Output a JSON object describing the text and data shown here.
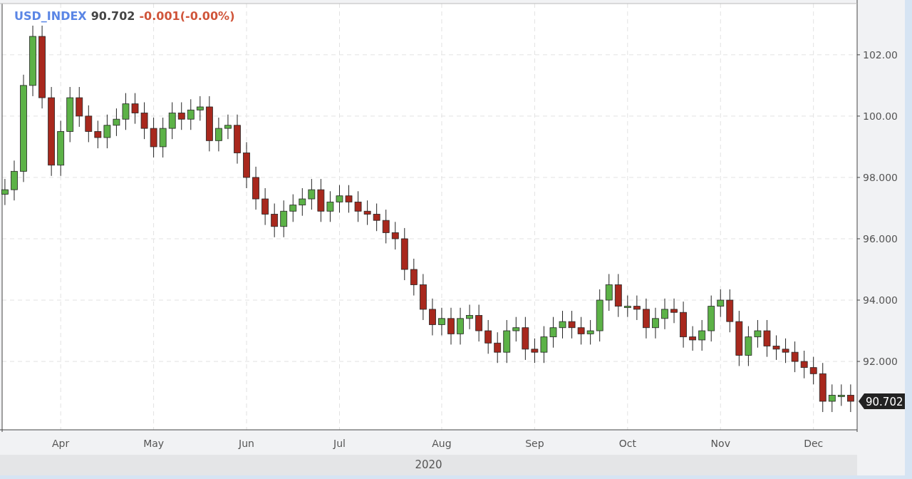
{
  "header": {
    "symbol": "USD_INDEX",
    "price": "90.702",
    "change": "-0.001(-0.00%)"
  },
  "chart_data": {
    "type": "candlestick",
    "grid": true,
    "categories": [
      null,
      null,
      null,
      null,
      null,
      null,
      "Apr",
      null,
      null,
      null,
      null,
      null,
      null,
      null,
      null,
      null,
      "May",
      null,
      null,
      null,
      null,
      null,
      null,
      null,
      null,
      null,
      "Jun",
      null,
      null,
      null,
      null,
      null,
      null,
      null,
      null,
      null,
      "Jul",
      null,
      null,
      null,
      null,
      null,
      null,
      null,
      null,
      null,
      null,
      "Aug",
      null,
      null,
      null,
      null,
      null,
      null,
      null,
      null,
      null,
      "Sep",
      null,
      null,
      null,
      null,
      null,
      null,
      null,
      null,
      null,
      "Oct",
      null,
      null,
      null,
      null,
      null,
      null,
      null,
      null,
      null,
      "Nov",
      null,
      null,
      null,
      null,
      null,
      null,
      null,
      null,
      null,
      "Dec",
      null,
      null,
      null,
      null
    ],
    "ohlc": [
      [
        97.45,
        97.95,
        97.1,
        97.6
      ],
      [
        97.6,
        98.55,
        97.25,
        98.2
      ],
      [
        98.2,
        101.35,
        97.85,
        101.0
      ],
      [
        101.0,
        102.95,
        100.65,
        102.6
      ],
      [
        102.6,
        102.95,
        100.25,
        100.6
      ],
      [
        100.6,
        100.95,
        98.05,
        98.4
      ],
      [
        98.4,
        99.85,
        98.05,
        99.5
      ],
      [
        99.5,
        100.95,
        99.15,
        100.6
      ],
      [
        100.6,
        100.95,
        99.65,
        100.0
      ],
      [
        100.0,
        100.35,
        99.15,
        99.5
      ],
      [
        99.5,
        99.85,
        98.95,
        99.3
      ],
      [
        99.3,
        100.05,
        98.95,
        99.7
      ],
      [
        99.7,
        100.25,
        99.35,
        99.9
      ],
      [
        99.9,
        100.75,
        99.55,
        100.4
      ],
      [
        100.4,
        100.75,
        99.75,
        100.1
      ],
      [
        100.1,
        100.45,
        99.25,
        99.6
      ],
      [
        99.6,
        99.95,
        98.65,
        99.0
      ],
      [
        99.0,
        99.95,
        98.65,
        99.6
      ],
      [
        99.6,
        100.45,
        99.25,
        100.1
      ],
      [
        100.1,
        100.45,
        99.55,
        99.9
      ],
      [
        99.9,
        100.55,
        99.55,
        100.2
      ],
      [
        100.2,
        100.65,
        99.85,
        100.3
      ],
      [
        100.3,
        100.65,
        98.85,
        99.2
      ],
      [
        99.2,
        99.95,
        98.85,
        99.6
      ],
      [
        99.6,
        100.05,
        99.25,
        99.7
      ],
      [
        99.7,
        100.05,
        98.45,
        98.8
      ],
      [
        98.8,
        99.15,
        97.65,
        98.0
      ],
      [
        98.0,
        98.35,
        96.95,
        97.3
      ],
      [
        97.3,
        97.65,
        96.45,
        96.8
      ],
      [
        96.8,
        97.15,
        96.05,
        96.4
      ],
      [
        96.4,
        97.25,
        96.05,
        96.9
      ],
      [
        96.9,
        97.45,
        96.55,
        97.1
      ],
      [
        97.1,
        97.65,
        96.75,
        97.3
      ],
      [
        97.3,
        97.95,
        96.95,
        97.6
      ],
      [
        97.6,
        97.95,
        96.55,
        96.9
      ],
      [
        96.9,
        97.55,
        96.55,
        97.2
      ],
      [
        97.2,
        97.75,
        96.85,
        97.4
      ],
      [
        97.4,
        97.75,
        96.85,
        97.2
      ],
      [
        97.2,
        97.55,
        96.55,
        96.9
      ],
      [
        96.9,
        97.25,
        96.45,
        96.8
      ],
      [
        96.8,
        97.15,
        96.25,
        96.6
      ],
      [
        96.6,
        96.95,
        95.85,
        96.2
      ],
      [
        96.2,
        96.55,
        95.65,
        96.0
      ],
      [
        96.0,
        96.35,
        94.65,
        95.0
      ],
      [
        95.0,
        95.35,
        94.15,
        94.5
      ],
      [
        94.5,
        94.85,
        93.35,
        93.7
      ],
      [
        93.7,
        94.05,
        92.85,
        93.2
      ],
      [
        93.2,
        93.75,
        92.85,
        93.4
      ],
      [
        93.4,
        93.75,
        92.55,
        92.9
      ],
      [
        92.9,
        93.75,
        92.55,
        93.4
      ],
      [
        93.4,
        93.85,
        93.05,
        93.5
      ],
      [
        93.5,
        93.85,
        92.65,
        93.0
      ],
      [
        93.0,
        93.35,
        92.25,
        92.6
      ],
      [
        92.6,
        92.95,
        91.95,
        92.3
      ],
      [
        92.3,
        93.35,
        91.95,
        93.0
      ],
      [
        93.0,
        93.45,
        92.65,
        93.1
      ],
      [
        93.1,
        93.45,
        92.05,
        92.4
      ],
      [
        92.4,
        92.75,
        91.95,
        92.3
      ],
      [
        92.3,
        93.15,
        91.95,
        92.8
      ],
      [
        92.8,
        93.45,
        92.45,
        93.1
      ],
      [
        93.1,
        93.65,
        92.75,
        93.3
      ],
      [
        93.3,
        93.65,
        92.75,
        93.1
      ],
      [
        93.1,
        93.45,
        92.55,
        92.9
      ],
      [
        92.9,
        93.35,
        92.55,
        93.0
      ],
      [
        93.0,
        94.35,
        92.65,
        94.0
      ],
      [
        94.0,
        94.85,
        93.65,
        94.5
      ],
      [
        94.5,
        94.85,
        93.45,
        93.8
      ],
      [
        93.8,
        94.15,
        93.45,
        93.8
      ],
      [
        93.8,
        94.15,
        93.35,
        93.7
      ],
      [
        93.7,
        94.05,
        92.75,
        93.1
      ],
      [
        93.1,
        93.75,
        92.75,
        93.4
      ],
      [
        93.4,
        94.05,
        93.05,
        93.7
      ],
      [
        93.7,
        94.05,
        93.25,
        93.6
      ],
      [
        93.6,
        93.95,
        92.45,
        92.8
      ],
      [
        92.8,
        93.15,
        92.35,
        92.7
      ],
      [
        92.7,
        93.35,
        92.35,
        93.0
      ],
      [
        93.0,
        94.15,
        92.65,
        93.8
      ],
      [
        93.8,
        94.35,
        93.45,
        94.0
      ],
      [
        94.0,
        94.35,
        92.95,
        93.3
      ],
      [
        93.3,
        93.65,
        91.85,
        92.2
      ],
      [
        92.2,
        93.15,
        91.85,
        92.8
      ],
      [
        92.8,
        93.35,
        92.45,
        93.0
      ],
      [
        93.0,
        93.35,
        92.15,
        92.5
      ],
      [
        92.5,
        92.85,
        92.05,
        92.4
      ],
      [
        92.4,
        92.75,
        91.95,
        92.3
      ],
      [
        92.3,
        92.65,
        91.65,
        92.0
      ],
      [
        92.0,
        92.35,
        91.45,
        91.8
      ],
      [
        91.8,
        92.15,
        91.25,
        91.6
      ],
      [
        91.6,
        91.95,
        90.35,
        90.7
      ],
      [
        90.7,
        91.25,
        90.35,
        90.9
      ],
      [
        90.9,
        91.25,
        90.55,
        90.9
      ],
      [
        90.9,
        91.25,
        90.35,
        90.7
      ]
    ],
    "ylim": [
      89.77,
      103.67
    ],
    "yticks": [
      {
        "value": 92,
        "label": "92.000"
      },
      {
        "value": 94,
        "label": "94.000"
      },
      {
        "value": 96,
        "label": "96.000"
      },
      {
        "value": 98,
        "label": "98.000"
      },
      {
        "value": 100,
        "label": "100.00"
      },
      {
        "value": 102,
        "label": "102.00"
      }
    ]
  },
  "last_price_tag": "90.702",
  "year_label": "2020"
}
